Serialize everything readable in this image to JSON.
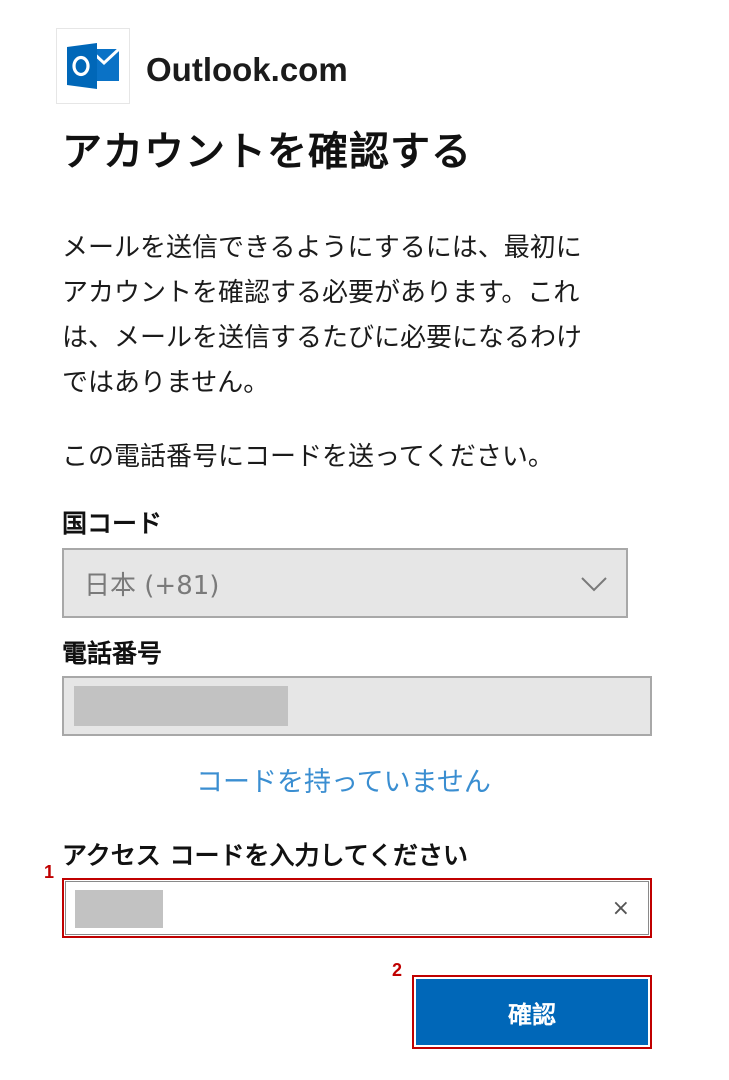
{
  "brand": {
    "name": "Outlook.com",
    "icon": "outlook-logo-icon",
    "color": "#0067b8"
  },
  "page": {
    "title": "アカウントを確認する",
    "description_lines": [
      "メールを送信できるようにするには、最初に",
      "アカウントを確認する必要があります。これ",
      "は、メールを送信するたびに必要になるわけ",
      "ではありません。"
    ],
    "instruction": "この電話番号にコードを送ってください。"
  },
  "country": {
    "label": "国コード",
    "value": "日本 (+81)"
  },
  "phone": {
    "label": "電話番号",
    "value": ""
  },
  "link": {
    "no_code": "コードを持っていません"
  },
  "access_code": {
    "label": "アクセス コードを入力してください",
    "value": "",
    "clear_label": "×"
  },
  "actions": {
    "confirm_label": "確認"
  },
  "annotations": {
    "step1": "1",
    "step2": "2",
    "color": "#c00000"
  }
}
